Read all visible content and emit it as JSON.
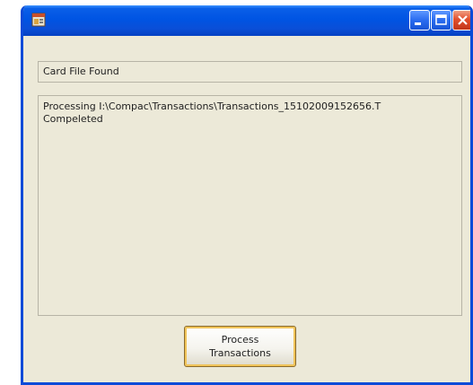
{
  "window": {
    "title": ""
  },
  "status": {
    "value": "Card File Found"
  },
  "log": {
    "lines": [
      "Processing I:\\Compac\\Transactions\\Transactions_15102009152656.T",
      "Compeleted"
    ]
  },
  "actions": {
    "process_label_line1": "Process",
    "process_label_line2": "Transactions"
  },
  "icons": {
    "app": "application-icon",
    "minimize": "minimize-icon",
    "maximize": "maximize-icon",
    "close": "close-icon"
  },
  "colors": {
    "titlebar": "#0054e3",
    "window_bg": "#ece9d8",
    "close_button": "#e2502e",
    "button_focus": "#f0c45a"
  }
}
